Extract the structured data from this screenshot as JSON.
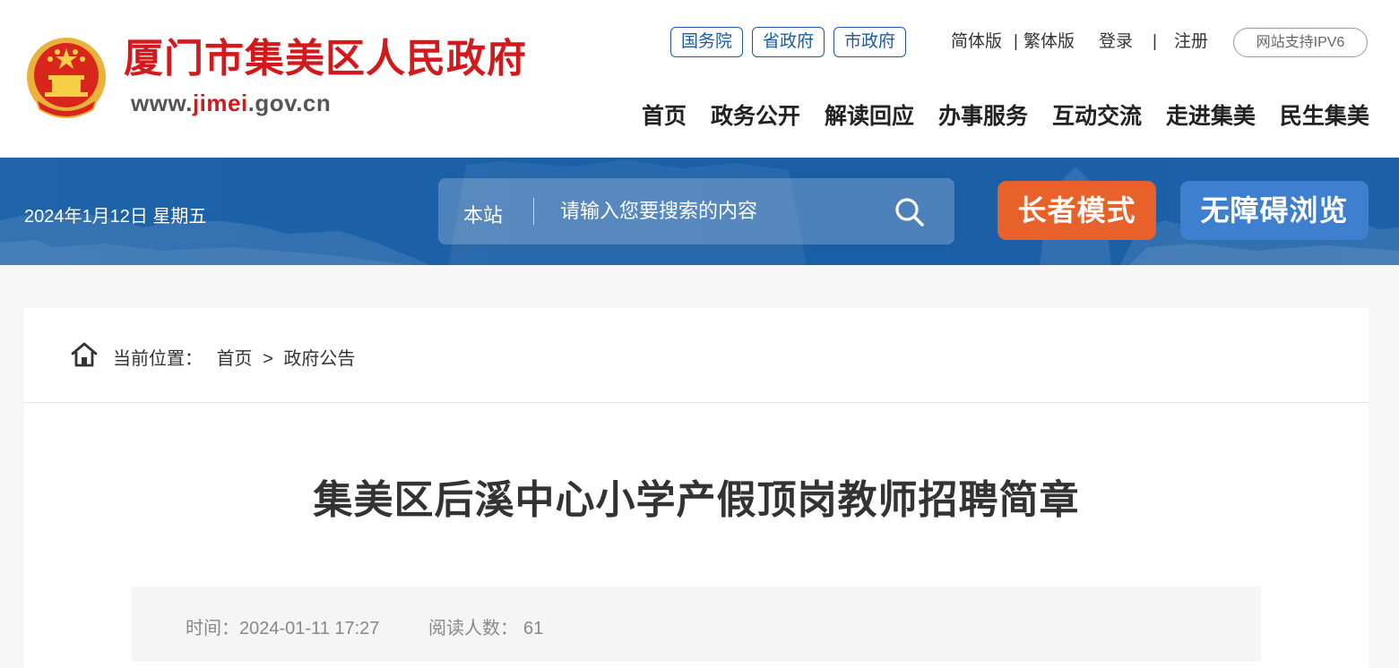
{
  "header": {
    "site_title": "厦门市集美区人民政府",
    "domain_prefix": "www.",
    "domain_highlight": "jimei",
    "domain_suffix": ".gov.cn",
    "gov_links": [
      "国务院",
      "省政府",
      "市政府"
    ],
    "lang_simplified": "简体版",
    "lang_sep": "|",
    "lang_traditional": "繁体版",
    "login": "登录",
    "auth_sep": "|",
    "register": "注册",
    "ipv6_badge": "网站支持IPV6",
    "nav": [
      "首页",
      "政务公开",
      "解读回应",
      "办事服务",
      "互动交流",
      "走进集美",
      "民生集美"
    ]
  },
  "banner": {
    "date": "2024年1月12日 星期五",
    "search_scope": "本站",
    "search_placeholder": "请输入您要搜索的内容",
    "elder_mode": "长者模式",
    "accessible_browse": "无障碍浏览"
  },
  "breadcrumb": {
    "label": "当前位置：",
    "home": "首页",
    "sep": ">",
    "current": "政府公告"
  },
  "article": {
    "title": "集美区后溪中心小学产假顶岗教师招聘简章",
    "time_label": "时间：",
    "time_value": "2024-01-11 17:27",
    "views_label": "阅读人数：",
    "views_value": "61"
  },
  "colors": {
    "brand_red": "#d2191c",
    "brand_blue": "#1b5aa3",
    "elder_orange": "#e8602a",
    "access_blue": "#3f7fd0"
  }
}
